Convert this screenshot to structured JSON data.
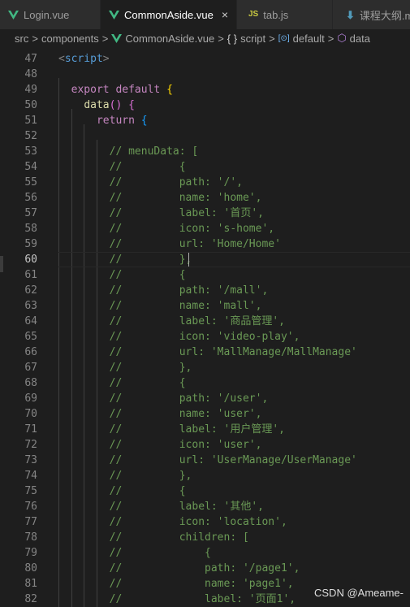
{
  "tabs": [
    {
      "label": "Login.vue",
      "icon": "vue-icon",
      "active": false
    },
    {
      "label": "CommonAside.vue",
      "icon": "vue-icon",
      "active": true,
      "close": "×"
    },
    {
      "label": "tab.js",
      "icon": "js-icon",
      "icon_text": "JS",
      "active": false
    },
    {
      "label": "课程大纲.m",
      "icon": "markdown-download-icon",
      "icon_text": "⬇",
      "active": false
    }
  ],
  "breadcrumb": {
    "src": "src",
    "components": "components",
    "file": "CommonAside.vue",
    "script_icon": "{ }",
    "script": "script",
    "default_icon": "[⊙]",
    "default": "default",
    "data_icon": "⬡",
    "data": "data",
    "sep": ">"
  },
  "colors": {
    "keyword": "#569cd6",
    "control": "#c586c0",
    "function": "#dcdcaa",
    "comment": "#6a9955",
    "bracket_gold": "#ffd700",
    "bracket_purple": "#da70d6",
    "bracket_blue": "#179fff",
    "vue": "#41b883",
    "js": "#cbcb41"
  },
  "current_line": "60",
  "lines": [
    {
      "num": "47",
      "segs": [
        {
          "t": "<",
          "c": "tag"
        },
        {
          "t": "script",
          "c": "tagname"
        },
        {
          "t": ">",
          "c": "tag"
        }
      ]
    },
    {
      "num": "48",
      "segs": []
    },
    {
      "num": "49",
      "segs": [
        {
          "t": "  "
        },
        {
          "t": "export",
          "c": "kw2"
        },
        {
          "t": " "
        },
        {
          "t": "default",
          "c": "kw2"
        },
        {
          "t": " "
        },
        {
          "t": "{",
          "c": "br1"
        }
      ]
    },
    {
      "num": "50",
      "segs": [
        {
          "t": "    "
        },
        {
          "t": "data",
          "c": "fn"
        },
        {
          "t": "() ",
          "c": "br2"
        },
        {
          "t": "{",
          "c": "br2"
        }
      ]
    },
    {
      "num": "51",
      "segs": [
        {
          "t": "      "
        },
        {
          "t": "return",
          "c": "kw2"
        },
        {
          "t": " "
        },
        {
          "t": "{",
          "c": "br3"
        }
      ]
    },
    {
      "num": "52",
      "segs": []
    },
    {
      "num": "53",
      "segs": [
        {
          "t": "        "
        },
        {
          "t": "// menuData: [",
          "c": "cm"
        }
      ]
    },
    {
      "num": "54",
      "segs": [
        {
          "t": "        "
        },
        {
          "t": "//         {",
          "c": "cm"
        }
      ]
    },
    {
      "num": "55",
      "segs": [
        {
          "t": "        "
        },
        {
          "t": "//         path: '/',",
          "c": "cm"
        }
      ]
    },
    {
      "num": "56",
      "segs": [
        {
          "t": "        "
        },
        {
          "t": "//         name: 'home',",
          "c": "cm"
        }
      ]
    },
    {
      "num": "57",
      "segs": [
        {
          "t": "        "
        },
        {
          "t": "//         label: '首页',",
          "c": "cm"
        }
      ]
    },
    {
      "num": "58",
      "segs": [
        {
          "t": "        "
        },
        {
          "t": "//         icon: 's-home',",
          "c": "cm"
        }
      ]
    },
    {
      "num": "59",
      "segs": [
        {
          "t": "        "
        },
        {
          "t": "//         url: 'Home/Home'",
          "c": "cm"
        }
      ]
    },
    {
      "num": "60",
      "segs": [
        {
          "t": "        "
        },
        {
          "t": "//         },",
          "c": "cm"
        }
      ]
    },
    {
      "num": "61",
      "segs": [
        {
          "t": "        "
        },
        {
          "t": "//         {",
          "c": "cm"
        }
      ]
    },
    {
      "num": "62",
      "segs": [
        {
          "t": "        "
        },
        {
          "t": "//         path: '/mall',",
          "c": "cm"
        }
      ]
    },
    {
      "num": "63",
      "segs": [
        {
          "t": "        "
        },
        {
          "t": "//         name: 'mall',",
          "c": "cm"
        }
      ]
    },
    {
      "num": "64",
      "segs": [
        {
          "t": "        "
        },
        {
          "t": "//         label: '商品管理',",
          "c": "cm"
        }
      ]
    },
    {
      "num": "65",
      "segs": [
        {
          "t": "        "
        },
        {
          "t": "//         icon: 'video-play',",
          "c": "cm"
        }
      ]
    },
    {
      "num": "66",
      "segs": [
        {
          "t": "        "
        },
        {
          "t": "//         url: 'MallManage/MallManage'",
          "c": "cm"
        }
      ]
    },
    {
      "num": "67",
      "segs": [
        {
          "t": "        "
        },
        {
          "t": "//         },",
          "c": "cm"
        }
      ]
    },
    {
      "num": "68",
      "segs": [
        {
          "t": "        "
        },
        {
          "t": "//         {",
          "c": "cm"
        }
      ]
    },
    {
      "num": "69",
      "segs": [
        {
          "t": "        "
        },
        {
          "t": "//         path: '/user',",
          "c": "cm"
        }
      ]
    },
    {
      "num": "70",
      "segs": [
        {
          "t": "        "
        },
        {
          "t": "//         name: 'user',",
          "c": "cm"
        }
      ]
    },
    {
      "num": "71",
      "segs": [
        {
          "t": "        "
        },
        {
          "t": "//         label: '用户管理',",
          "c": "cm"
        }
      ]
    },
    {
      "num": "72",
      "segs": [
        {
          "t": "        "
        },
        {
          "t": "//         icon: 'user',",
          "c": "cm"
        }
      ]
    },
    {
      "num": "73",
      "segs": [
        {
          "t": "        "
        },
        {
          "t": "//         url: 'UserManage/UserManage'",
          "c": "cm"
        }
      ]
    },
    {
      "num": "74",
      "segs": [
        {
          "t": "        "
        },
        {
          "t": "//         },",
          "c": "cm"
        }
      ]
    },
    {
      "num": "75",
      "segs": [
        {
          "t": "        "
        },
        {
          "t": "//         {",
          "c": "cm"
        }
      ]
    },
    {
      "num": "76",
      "segs": [
        {
          "t": "        "
        },
        {
          "t": "//         label: '其他',",
          "c": "cm"
        }
      ]
    },
    {
      "num": "77",
      "segs": [
        {
          "t": "        "
        },
        {
          "t": "//         icon: 'location',",
          "c": "cm"
        }
      ]
    },
    {
      "num": "78",
      "segs": [
        {
          "t": "        "
        },
        {
          "t": "//         children: [",
          "c": "cm"
        }
      ]
    },
    {
      "num": "79",
      "segs": [
        {
          "t": "        "
        },
        {
          "t": "//             {",
          "c": "cm"
        }
      ]
    },
    {
      "num": "80",
      "segs": [
        {
          "t": "        "
        },
        {
          "t": "//             path: '/page1',",
          "c": "cm"
        }
      ]
    },
    {
      "num": "81",
      "segs": [
        {
          "t": "        "
        },
        {
          "t": "//             name: 'page1',",
          "c": "cm"
        }
      ]
    },
    {
      "num": "82",
      "segs": [
        {
          "t": "        "
        },
        {
          "t": "//             label: '页面1',",
          "c": "cm"
        }
      ]
    }
  ],
  "watermark": "CSDN @Ameame-"
}
